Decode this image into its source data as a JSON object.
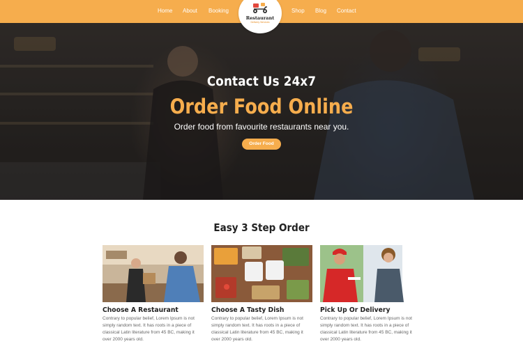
{
  "nav": {
    "links_left": [
      "Home",
      "About",
      "Booking"
    ],
    "links_right": [
      "Shop",
      "Blog",
      "Contact"
    ],
    "logo_title": "Restaurant",
    "logo_subtitle": "Delivery Services",
    "logo_icon": "scooter-icon"
  },
  "hero": {
    "kicker": "Contact Us 24x7",
    "title": "Order Food Online",
    "subtitle": "Order food from favourite restaurants near you.",
    "button": "Order Food"
  },
  "steps": {
    "title": "Easy 3 Step Order",
    "cards": [
      {
        "title": "Choose A Restaurant",
        "text": "Contrary to popular belief, Lorem Ipsum is not simply random text. It has roots in a piece of classical Latin literature from 45 BC, making it over 2000 years old."
      },
      {
        "title": "Choose A Tasty Dish",
        "text": "Contrary to popular belief, Lorem Ipsum is not simply random text. It has roots in a piece of classical Latin literature from 45 BC, making it over 2000 years old."
      },
      {
        "title": "Pick Up Or Delivery",
        "text": "Contrary to popular belief, Lorem Ipsum is not simply random text. It has roots in a piece of classical Latin literature from 45 BC, making it over 2000 years old."
      }
    ]
  },
  "colors": {
    "accent": "#f6ad4d",
    "dark": "#222222",
    "body_text": "#666666"
  }
}
